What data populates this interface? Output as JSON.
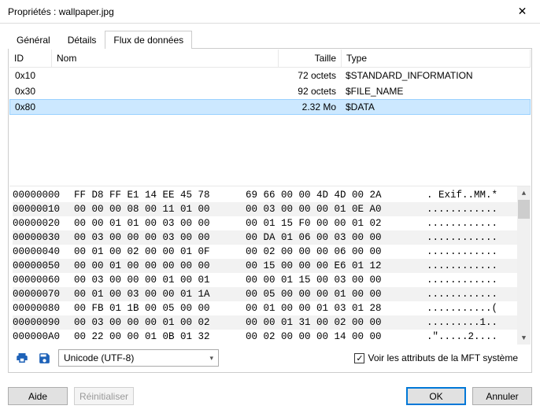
{
  "window": {
    "title": "Propriétés : wallpaper.jpg"
  },
  "tabs": {
    "general": "Général",
    "details": "Détails",
    "streams": "Flux de données"
  },
  "table": {
    "headers": {
      "id": "ID",
      "nom": "Nom",
      "taille": "Taille",
      "type": "Type"
    },
    "rows": [
      {
        "id": "0x10",
        "nom": "",
        "taille": "72 octets",
        "type": "$STANDARD_INFORMATION"
      },
      {
        "id": "0x30",
        "nom": "",
        "taille": "92 octets",
        "type": "$FILE_NAME"
      },
      {
        "id": "0x80",
        "nom": "",
        "taille": "2.32 Mo",
        "type": "$DATA"
      }
    ]
  },
  "hex": [
    {
      "off": "00000000",
      "b1": "FF D8 FF E1 14 EE 45 78",
      "b2": "69 66 00 00 4D 4D 00 2A",
      "a": ". Exif..MM.*"
    },
    {
      "off": "00000010",
      "b1": "00 00 00 08 00 11 01 00",
      "b2": "00 03 00 00 00 01 0E A0",
      "a": "............"
    },
    {
      "off": "00000020",
      "b1": "00 00 01 01 00 03 00 00",
      "b2": "00 01 15 F0 00 00 01 02",
      "a": "............"
    },
    {
      "off": "00000030",
      "b1": "00 03 00 00 00 03 00 00",
      "b2": "00 DA 01 06 00 03 00 00",
      "a": "............"
    },
    {
      "off": "00000040",
      "b1": "00 01 00 02 00 00 01 0F",
      "b2": "00 02 00 00 00 06 00 00",
      "a": "............"
    },
    {
      "off": "00000050",
      "b1": "00 00 01 00 00 00 00 00",
      "b2": "00 15 00 00 00 E6 01 12",
      "a": "............"
    },
    {
      "off": "00000060",
      "b1": "00 03 00 00 00 01 00 01",
      "b2": "00 00 01 15 00 03 00 00",
      "a": "............"
    },
    {
      "off": "00000070",
      "b1": "00 01 00 03 00 00 01 1A",
      "b2": "00 05 00 00 00 01 00 00",
      "a": "............"
    },
    {
      "off": "00000080",
      "b1": "00 FB 01 1B 00 05 00 00",
      "b2": "00 01 00 00 01 03 01 28",
      "a": "...........("
    },
    {
      "off": "00000090",
      "b1": "00 03 00 00 00 01 00 02",
      "b2": "00 00 01 31 00 02 00 00",
      "a": ".........1.."
    },
    {
      "off": "000000A0",
      "b1": "00 22 00 00 01 0B 01 32",
      "b2": "00 02 00 00 00 14 00 00",
      "a": ".\".....2...."
    }
  ],
  "encoding": {
    "value": "Unicode (UTF-8)"
  },
  "checkbox": {
    "label": "Voir les attributs de la MFT système",
    "checked": true
  },
  "buttons": {
    "help": "Aide",
    "reset": "Réinitialiser",
    "ok": "OK",
    "cancel": "Annuler"
  }
}
